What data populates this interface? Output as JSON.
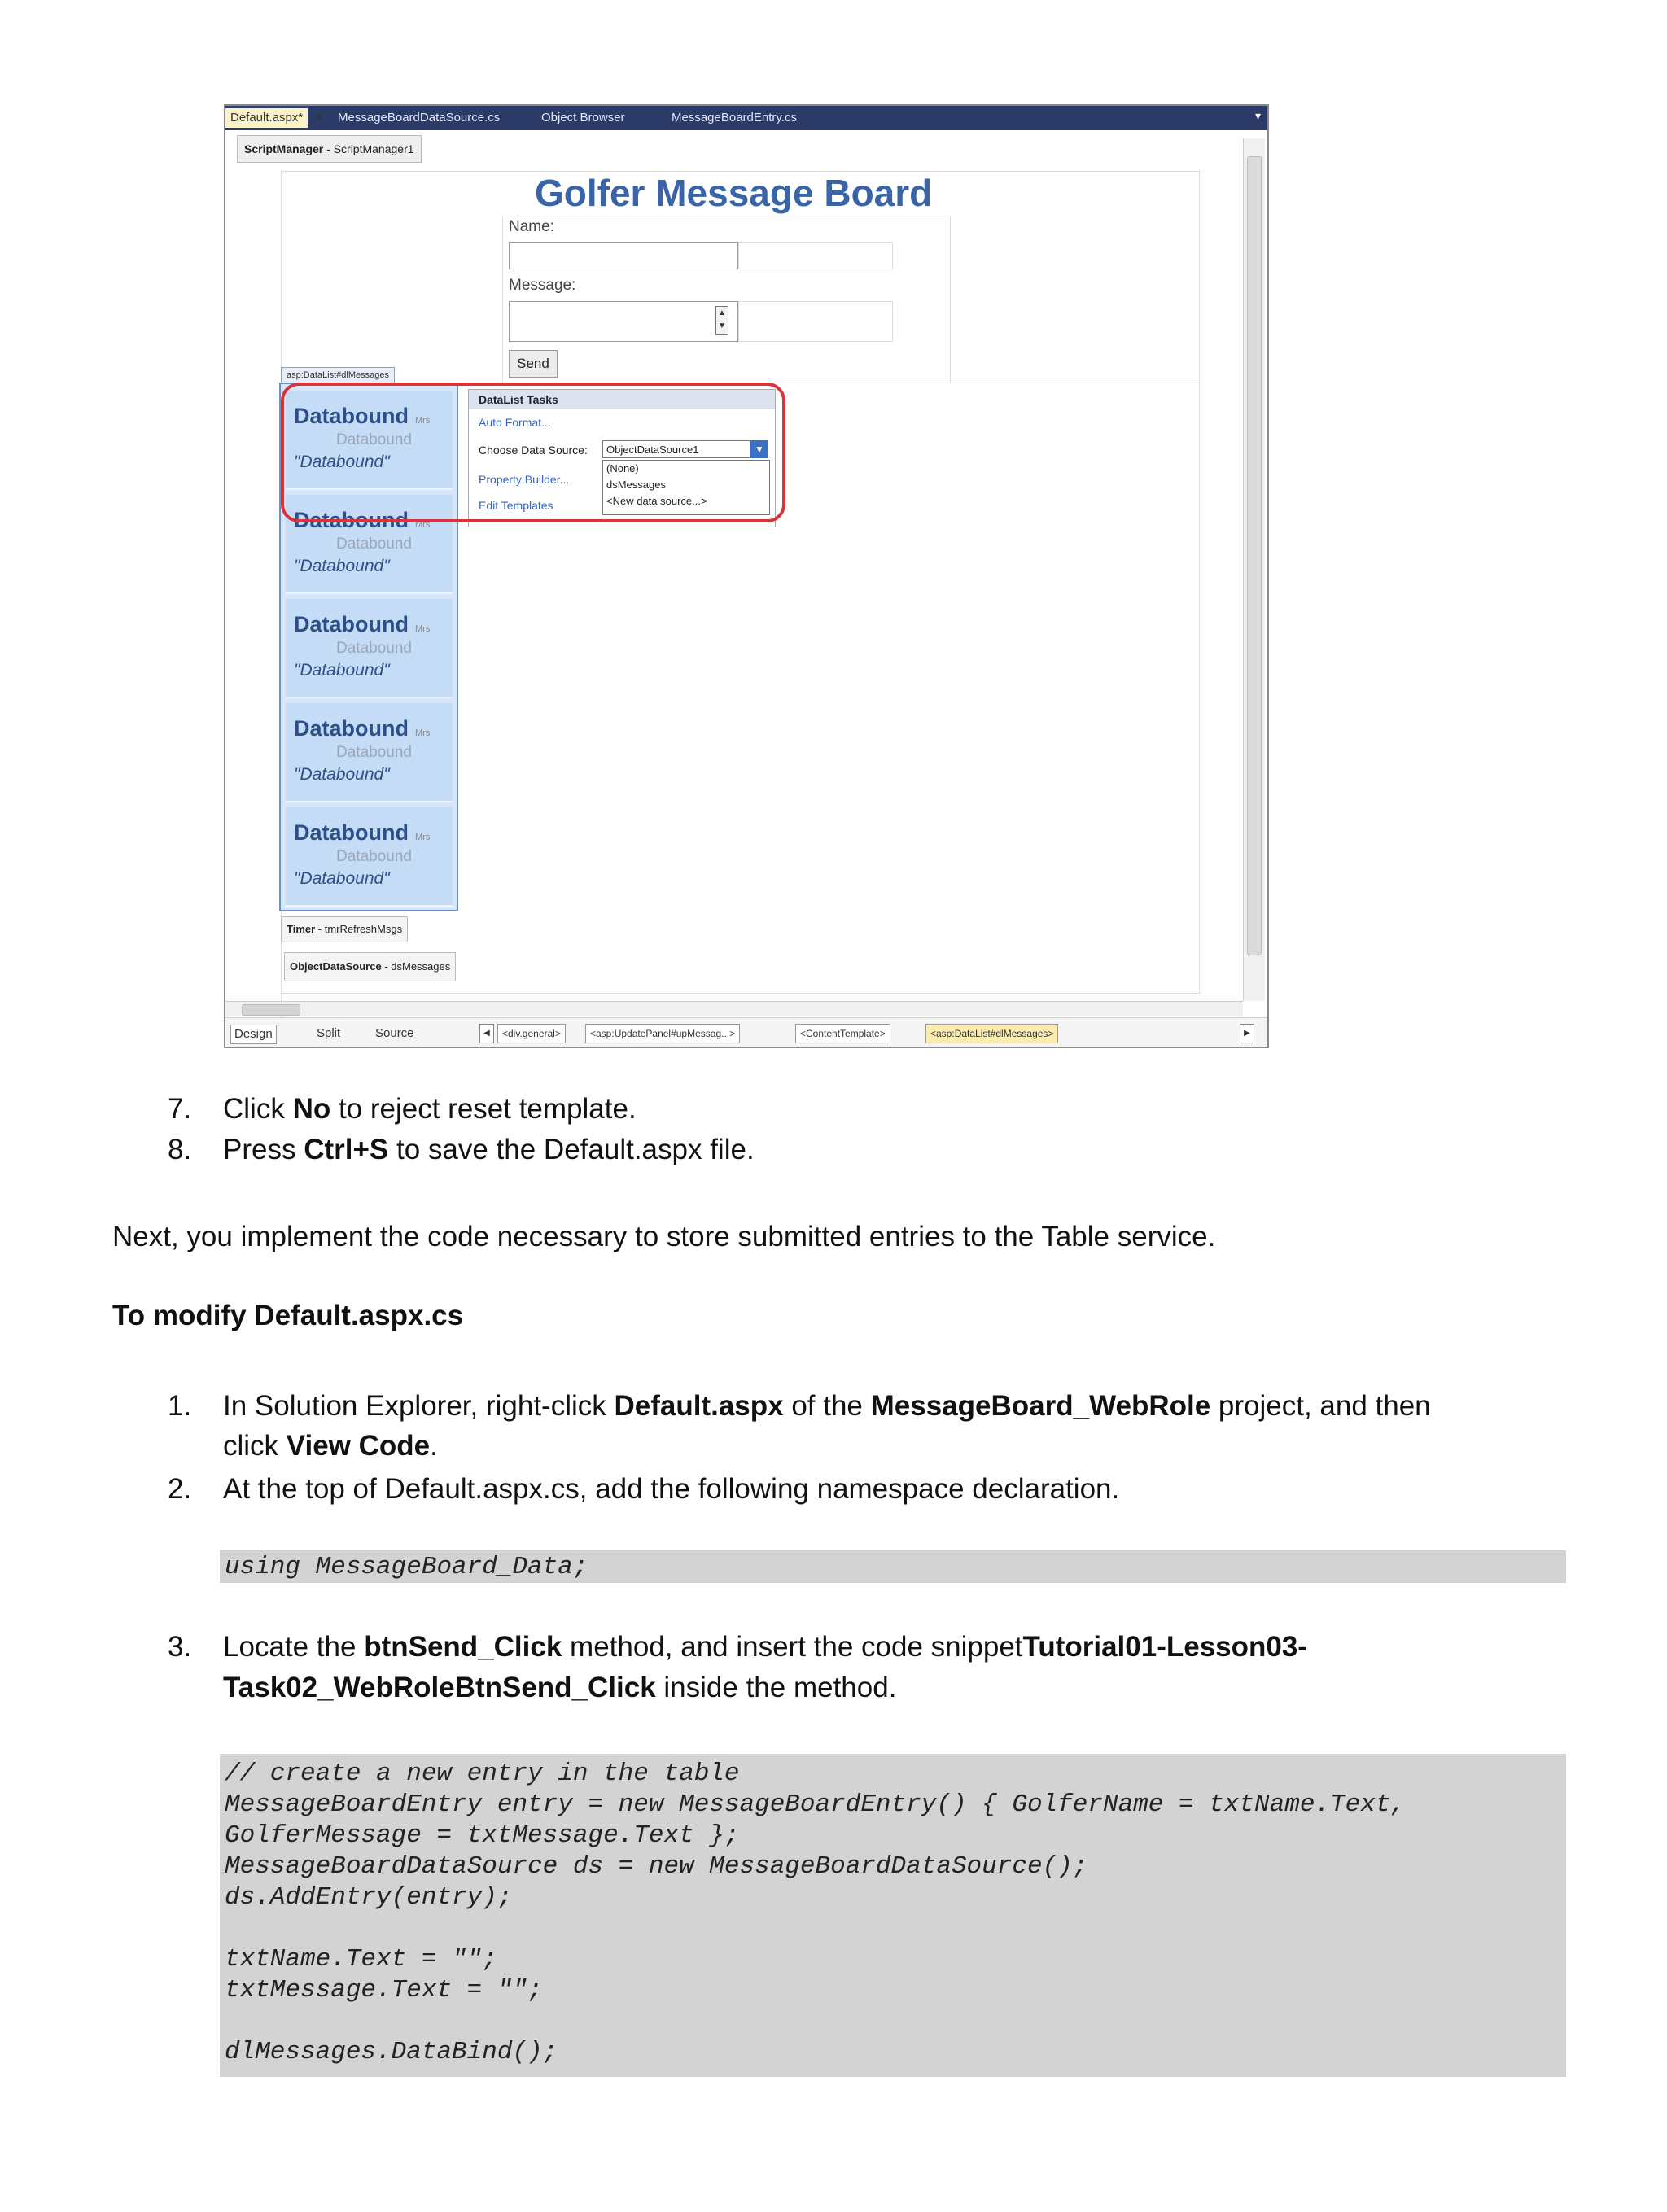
{
  "ide": {
    "tabs": [
      "Default.aspx*",
      "MessageBoardDataSource.cs",
      "Object Browser",
      "MessageBoardEntry.cs"
    ],
    "tab_close": "×",
    "tab_menu": "▾",
    "script_manager": {
      "type": "ScriptManager",
      "id": " - ScriptManager1"
    },
    "heading": "Golfer Message Board",
    "name_label": "Name:",
    "message_label": "Message:",
    "send_label": "Send",
    "datalist_tag": "asp:DataList#dlMessages",
    "item_title": "Databound",
    "item_small": "Mrs",
    "item_sub": "Databound",
    "item_quote": "\"Databound\"",
    "tasks": {
      "title": "DataList Tasks",
      "auto_format": "Auto Format...",
      "choose_ds_label": "Choose Data Source:",
      "selected_ds": "ObjectDataSource1",
      "property_builder": "Property Builder...",
      "edit_templates": "Edit Templates",
      "options": [
        "(None)",
        "dsMessages",
        "<New data source...>"
      ]
    },
    "timer": {
      "type": "Timer",
      "id": " - tmrRefreshMsgs"
    },
    "object_ds": {
      "type": "ObjectDataSource",
      "id": " - dsMessages"
    },
    "view_tabs": [
      "Design",
      "Split",
      "Source"
    ],
    "breadcrumbs": [
      "<div.general>",
      "<asp:UpdatePanel#upMessag...>",
      "<ContentTemplate>",
      "<asp:DataList#dlMessages>"
    ]
  },
  "steps_a": [
    {
      "num": "7.",
      "pre": "Click ",
      "bold": "No",
      "post": " to reject reset template."
    },
    {
      "num": "8.",
      "pre": "Press ",
      "bold": "Ctrl+S",
      "post": " to save the Default.aspx file."
    }
  ],
  "next_para": "Next, you implement the code necessary to store submitted entries to the Table service.",
  "section_heading": "To modify Default.aspx.cs",
  "step1": {
    "num": "1.",
    "t1": "In Solution Explorer, right-click ",
    "b1": "Default.aspx",
    "t2": " of the ",
    "b2": "MessageBoard_WebRole",
    "t3": " project, and then",
    "t4": "click ",
    "b3": "View Code",
    "t5": "."
  },
  "step2": {
    "num": "2.",
    "text": "At the top of Default.aspx.cs, add the following namespace declaration."
  },
  "code1": "using MessageBoard_Data;",
  "step3": {
    "num": "3.",
    "t1": "Locate the ",
    "b1": "btnSend_Click",
    "t2": " method, and insert the code snippet",
    "b2": "Tutorial01-Lesson03-",
    "b3": "Task02_WebRoleBtnSend_Click",
    "t3": " inside the method."
  },
  "code2": "// create a new entry in the table\nMessageBoardEntry entry = new MessageBoardEntry() { GolferName = txtName.Text,\nGolferMessage = txtMessage.Text };\nMessageBoardDataSource ds = new MessageBoardDataSource();\nds.AddEntry(entry);\n\ntxtName.Text = \"\";\ntxtMessage.Text = \"\";\n\ndlMessages.DataBind();"
}
